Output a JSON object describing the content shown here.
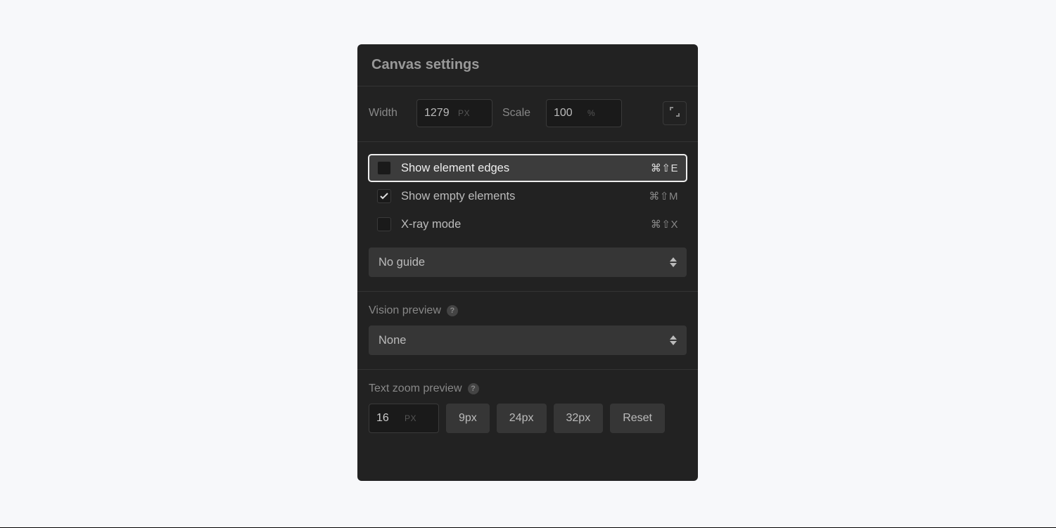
{
  "panel": {
    "title": "Canvas settings"
  },
  "dimensions": {
    "width_label": "Width",
    "width_value": "1279",
    "width_unit": "PX",
    "scale_label": "Scale",
    "scale_value": "100",
    "scale_unit": "%"
  },
  "options": {
    "edges": {
      "label": "Show element edges",
      "shortcut": "⌘⇧E"
    },
    "empty": {
      "label": "Show empty elements",
      "shortcut": "⌘⇧M"
    },
    "xray": {
      "label": "X-ray mode",
      "shortcut": "⌘⇧X"
    }
  },
  "guide": {
    "selected": "No guide"
  },
  "vision": {
    "label": "Vision preview",
    "selected": "None"
  },
  "textzoom": {
    "label": "Text zoom preview",
    "value": "16",
    "unit": "PX",
    "presets": [
      "9px",
      "24px",
      "32px"
    ],
    "reset": "Reset"
  }
}
